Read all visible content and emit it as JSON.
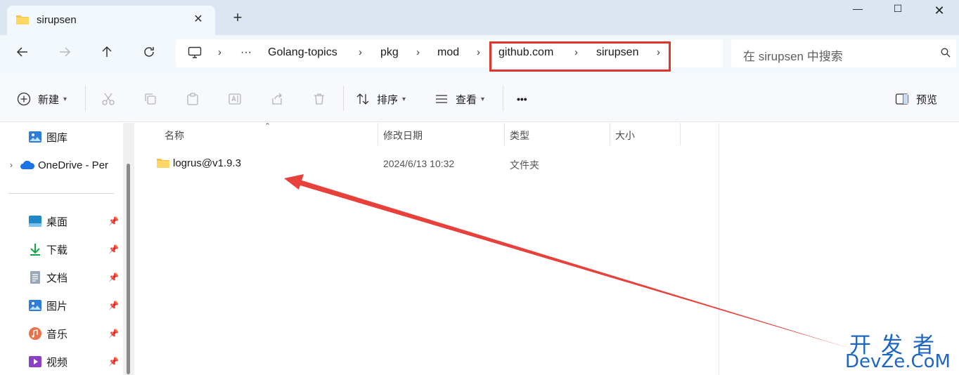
{
  "tab": {
    "title": "sirupsen",
    "close": "✕",
    "new_tab": "+"
  },
  "window": {
    "minimize": "—",
    "maximize": "☐",
    "close": "✕"
  },
  "breadcrumb": {
    "more": "···",
    "items": [
      "Golang-topics",
      "pkg",
      "mod",
      "github.com",
      "sirupsen"
    ],
    "sep": "›"
  },
  "search": {
    "placeholder": "在 sirupsen 中搜索"
  },
  "toolbar": {
    "new_label": "新建",
    "sort_label": "排序",
    "view_label": "查看",
    "more": "•••",
    "preview_label": "预览"
  },
  "sidebar": {
    "top": [
      {
        "label": "图库"
      },
      {
        "label": "OneDrive - Per"
      }
    ],
    "pinned": [
      {
        "label": "桌面"
      },
      {
        "label": "下载"
      },
      {
        "label": "文档"
      },
      {
        "label": "图片"
      },
      {
        "label": "音乐"
      },
      {
        "label": "视频"
      }
    ]
  },
  "columns": {
    "name": "名称",
    "modified": "修改日期",
    "type": "类型",
    "size": "大小"
  },
  "files": [
    {
      "name": "logrus@v1.9.3",
      "modified": "2024/6/13 10:32",
      "type": "文件夹",
      "size": ""
    }
  ],
  "watermark": {
    "cn": "开发者",
    "en": "DevZe.CoM"
  },
  "colors": {
    "highlight": "#e0342f",
    "arrow": "#e8403a",
    "accent": "#1e66c4"
  }
}
